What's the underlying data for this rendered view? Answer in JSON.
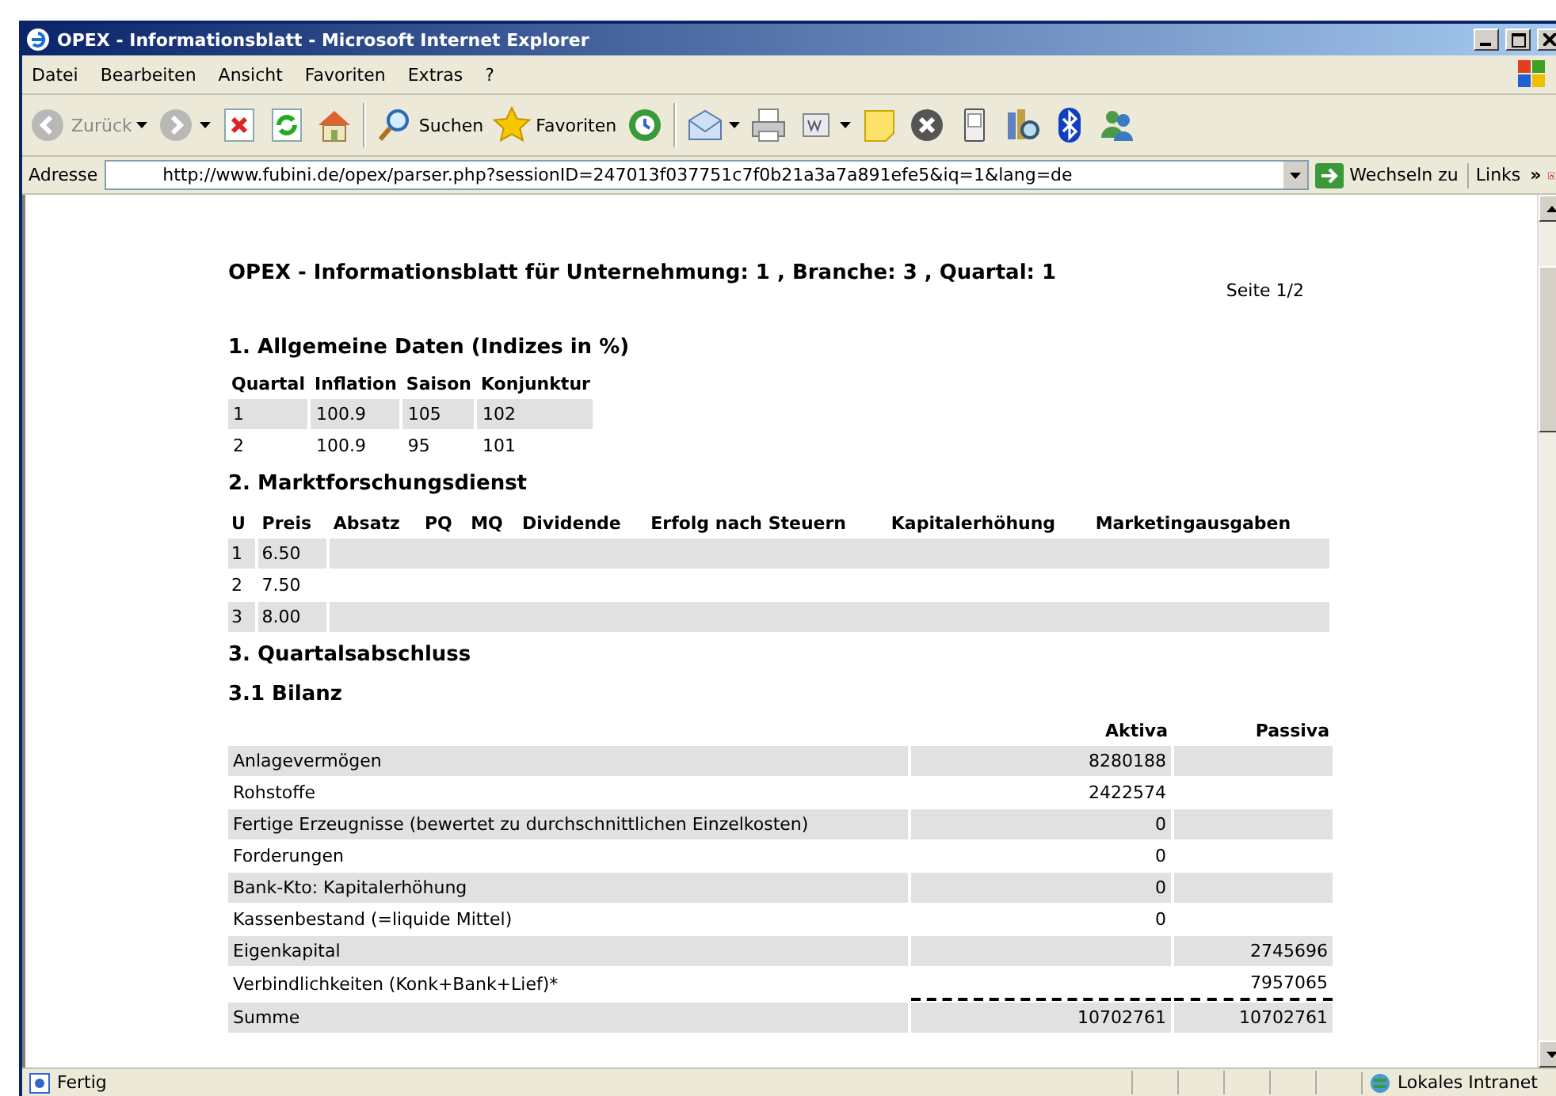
{
  "window": {
    "title": "OPEX - Informationsblatt - Microsoft Internet Explorer"
  },
  "menu": {
    "items": [
      "Datei",
      "Bearbeiten",
      "Ansicht",
      "Favoriten",
      "Extras",
      "?"
    ]
  },
  "toolbar": {
    "items": [
      {
        "kind": "back",
        "label": "Zurück",
        "dropdown": true
      },
      {
        "kind": "forward",
        "dropdown": true
      },
      {
        "kind": "stop"
      },
      {
        "kind": "refresh"
      },
      {
        "kind": "home"
      },
      {
        "kind": "separator"
      },
      {
        "kind": "search",
        "label": "Suchen"
      },
      {
        "kind": "favorites",
        "label": "Favoriten"
      },
      {
        "kind": "history"
      },
      {
        "kind": "separator"
      },
      {
        "kind": "mail",
        "dropdown": true
      },
      {
        "kind": "print"
      },
      {
        "kind": "edit",
        "dropdown": true
      },
      {
        "kind": "note"
      },
      {
        "kind": "close-circle"
      },
      {
        "kind": "device"
      },
      {
        "kind": "research"
      },
      {
        "kind": "bluetooth"
      },
      {
        "kind": "messenger"
      }
    ]
  },
  "address_bar": {
    "label": "Adresse",
    "value": "http://www.fubini.de/opex/parser.php?sessionID=247013f037751c7f0b21a3a7a891efe5&iq=1&lang=de",
    "go_label": "Wechseln zu",
    "links_label": "Links",
    "links_more": "»"
  },
  "page": {
    "title": "OPEX - Informationsblatt für Unternehmung: 1 , Branche: 3 , Quartal: 1",
    "page_number": "Seite 1/2",
    "general": {
      "heading": "1. Allgemeine Daten (Indizes in %)",
      "columns": [
        "Quartal",
        "Inflation",
        "Saison",
        "Konjunktur"
      ],
      "rows": [
        [
          "1",
          "100.9",
          "105",
          "102"
        ],
        [
          "2",
          "100.9",
          "95",
          "101"
        ]
      ]
    },
    "market": {
      "heading": "2. Marktforschungsdienst",
      "columns": [
        "U",
        "Preis",
        "Absatz",
        "PQ",
        "MQ",
        "Dividende",
        "Erfolg nach Steuern",
        "Kapitalerhöhung",
        "Marketingausgaben"
      ],
      "rows": [
        [
          "1",
          "6.50"
        ],
        [
          "2",
          "7.50"
        ],
        [
          "3",
          "8.00"
        ]
      ]
    },
    "closing": {
      "heading": "3. Quartalsabschluss",
      "subheading": "3.1 Bilanz",
      "columns": [
        "Aktiva",
        "Passiva"
      ],
      "rows": [
        {
          "label": "Anlagevermögen",
          "aktiva": "8280188"
        },
        {
          "label": "Rohstoffe",
          "aktiva": "2422574"
        },
        {
          "label": "Fertige Erzeugnisse (bewertet zu durchschnittlichen Einzelkosten)",
          "aktiva": "0"
        },
        {
          "label": "Forderungen",
          "aktiva": "0"
        },
        {
          "label": "Bank-Kto: Kapitalerhöhung",
          "aktiva": "0"
        },
        {
          "label": "Kassenbestand (=liquide Mittel)",
          "aktiva": "0"
        },
        {
          "label": "Eigenkapital",
          "passiva": "2745696"
        },
        {
          "label": "Verbindlichkeiten (Konk+Bank+Lief)*",
          "passiva": "7957065"
        },
        {
          "label": "Summe",
          "aktiva": "10702761",
          "passiva": "10702761",
          "dashed_rule_above": true
        }
      ]
    }
  },
  "status_bar": {
    "text": "Fertig",
    "zone": "Lokales Intranet"
  }
}
